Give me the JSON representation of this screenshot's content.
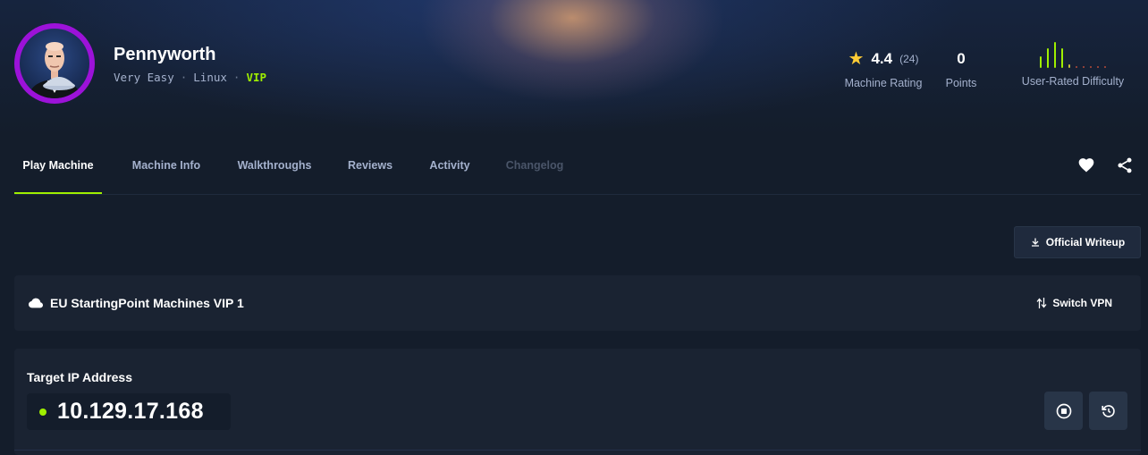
{
  "machine": {
    "name": "Pennyworth",
    "difficulty": "Very Easy",
    "os": "Linux",
    "tier": "VIP",
    "avatar_icon": "butler-avatar",
    "avatar_ring_color": "#9c12d9"
  },
  "stats": {
    "rating": {
      "value": "4.4",
      "count": "(24)",
      "label": "Machine Rating",
      "icon": "star-icon"
    },
    "points": {
      "value": "0",
      "label": "Points"
    },
    "difficulty": {
      "label": "User-Rated Difficulty",
      "bar_levels": [
        0.45,
        0.75,
        1.0,
        0.75,
        0.15,
        0.06,
        0.06,
        0.06,
        0.06,
        0.06
      ]
    }
  },
  "tabs": [
    {
      "label": "Play Machine",
      "active": true
    },
    {
      "label": "Machine Info"
    },
    {
      "label": "Walkthroughs"
    },
    {
      "label": "Reviews"
    },
    {
      "label": "Activity"
    },
    {
      "label": "Changelog",
      "disabled": true
    }
  ],
  "actions": {
    "official_writeup": "Official Writeup",
    "switch_vpn": "Switch VPN"
  },
  "vpn": {
    "server": "EU StartingPoint Machines VIP 1"
  },
  "target": {
    "label": "Target IP Address",
    "ip": "10.129.17.168",
    "status_color": "#9fef00"
  },
  "colors": {
    "accent": "#9fef00",
    "background": "#141d2b",
    "panel": "#1a2332",
    "star": "#ffcc35"
  }
}
